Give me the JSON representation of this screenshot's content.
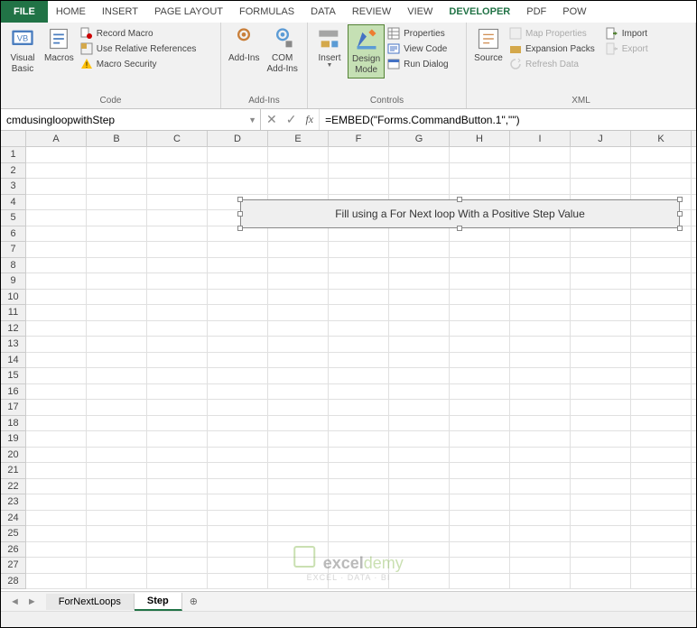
{
  "tabs": {
    "file": "FILE",
    "items": [
      "HOME",
      "INSERT",
      "PAGE LAYOUT",
      "FORMULAS",
      "DATA",
      "REVIEW",
      "VIEW",
      "DEVELOPER",
      "PDF",
      "POW"
    ],
    "active_index": 7
  },
  "ribbon": {
    "code": {
      "label": "Code",
      "visual_basic": "Visual\nBasic",
      "macros": "Macros",
      "record_macro": "Record Macro",
      "use_relative": "Use Relative References",
      "macro_security": "Macro Security"
    },
    "addins": {
      "label": "Add-Ins",
      "addins": "Add-Ins",
      "com_addins": "COM\nAdd-Ins"
    },
    "controls": {
      "label": "Controls",
      "insert": "Insert",
      "design_mode": "Design\nMode",
      "properties": "Properties",
      "view_code": "View Code",
      "run_dialog": "Run Dialog"
    },
    "xml": {
      "label": "XML",
      "source": "Source",
      "map_properties": "Map Properties",
      "expansion_packs": "Expansion Packs",
      "refresh_data": "Refresh Data",
      "import": "Import",
      "export": "Export"
    }
  },
  "formula_bar": {
    "name_box": "cmdusingloopwithStep",
    "formula": "=EMBED(\"Forms.CommandButton.1\",\"\")"
  },
  "grid": {
    "columns": [
      "A",
      "B",
      "C",
      "D",
      "E",
      "F",
      "G",
      "H",
      "I",
      "J",
      "K"
    ],
    "row_count": 28
  },
  "embedded_button": {
    "text": "Fill using a For Next loop With a Positive Step Value"
  },
  "watermark": {
    "brand_bold": "excel",
    "brand_light": "demy",
    "tagline": "EXCEL · DATA · BI"
  },
  "sheets": {
    "tabs": [
      "ForNextLoops",
      "Step"
    ],
    "active_index": 1,
    "new_sheet_icon": "⊕"
  }
}
